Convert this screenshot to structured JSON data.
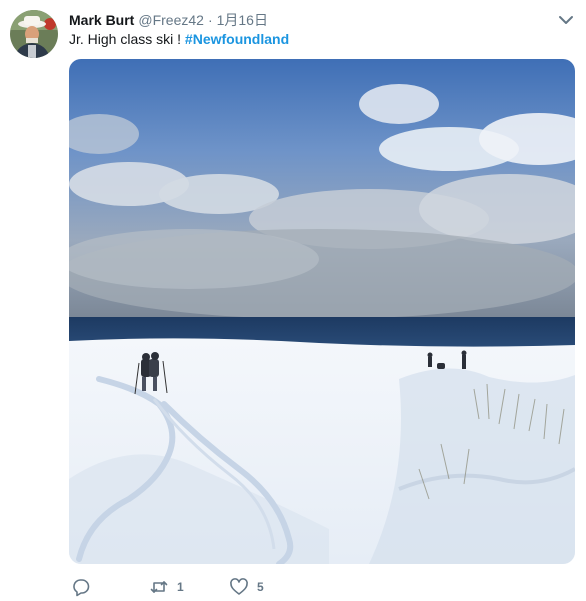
{
  "tweet": {
    "author_name": "Mark Burt",
    "author_handle": "@Freez42",
    "separator": "·",
    "timestamp": "1月16日",
    "text_plain": "Jr. High class ski ! ",
    "hashtag": "#Newfoundland",
    "photo_alt_icon": "photo-snow-ski-scene",
    "actions": {
      "reply_icon": "reply-icon",
      "retweet_icon": "retweet-icon",
      "retweet_count": "1",
      "like_icon": "heart-icon",
      "like_count": "5"
    }
  },
  "colors": {
    "name": "#14171a",
    "secondary": "#657786",
    "hashtag": "#1b95e0"
  }
}
